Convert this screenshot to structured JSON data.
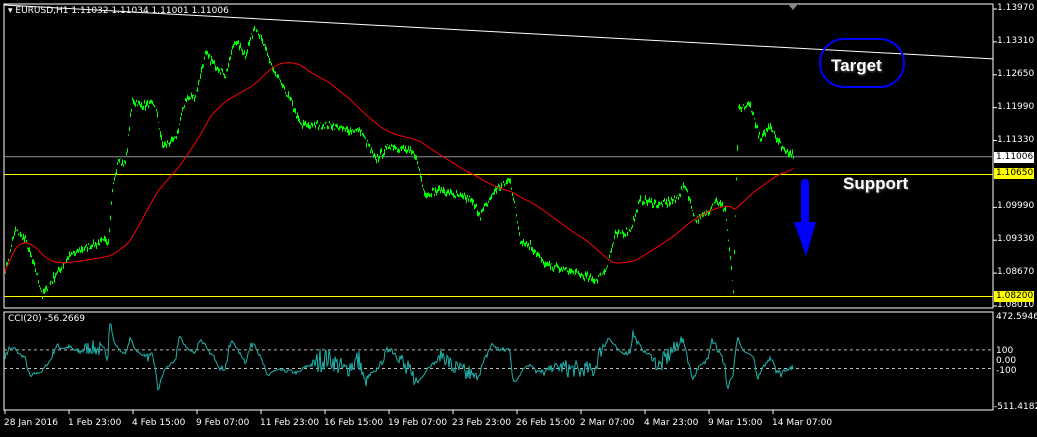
{
  "header": {
    "symbol_line": "EURUSD,H1  1.11032 1.11034 1.11001 1.11006"
  },
  "price_axis": {
    "ticks": [
      "1.13970",
      "1.13310",
      "1.12650",
      "1.11990",
      "1.11330",
      "1.09990",
      "1.09330",
      "1.08670",
      "1.08010"
    ],
    "tick_values": [
      1.1397,
      1.1331,
      1.1265,
      1.1199,
      1.1133,
      1.0999,
      1.0933,
      1.0867,
      1.0801
    ],
    "range": [
      1.0801,
      1.1397
    ],
    "current_price_label": "1.11006",
    "support_label": "1.10650",
    "lower_label": "1.08200"
  },
  "levels": {
    "current": 1.11006,
    "support": 1.1065,
    "lower": 1.082,
    "trendline_start": 1.1405,
    "trendline_end": 1.1297
  },
  "colors": {
    "price": "#00ff00",
    "ma": "#ff0000",
    "level": "#ffff00",
    "cci": "#20b2aa",
    "trend": "#ffffff",
    "annotation": "#0000ff"
  },
  "annotations": {
    "target": "Target",
    "support": "Support"
  },
  "indicator": {
    "label": "CCI(20) -56.2669",
    "top": "472.5946",
    "bottom": "-511.4182",
    "upper": "100",
    "zero": "0.00",
    "lower": "-100"
  },
  "time_axis": [
    "28 Jan 2016",
    "1 Feb 23:00",
    "4 Feb 15:00",
    "9 Feb 07:00",
    "11 Feb 23:00",
    "16 Feb 15:00",
    "19 Feb 07:00",
    "23 Feb 23:00",
    "26 Feb 15:00",
    "2 Mar 07:00",
    "4 Mar 23:00",
    "9 Mar 15:00",
    "14 Mar 07:00"
  ],
  "chart_data": {
    "type": "line",
    "title": "EURUSD,H1",
    "bars_total": 789,
    "price_keypoints": [
      [
        0,
        1.0873
      ],
      [
        10,
        1.0954
      ],
      [
        20,
        1.0933
      ],
      [
        30,
        1.0873
      ],
      [
        37,
        1.0823
      ],
      [
        50,
        1.0863
      ],
      [
        65,
        1.0903
      ],
      [
        85,
        1.0923
      ],
      [
        103,
        1.0933
      ],
      [
        107,
        1.1034
      ],
      [
        113,
        1.1094
      ],
      [
        120,
        1.1084
      ],
      [
        127,
        1.1214
      ],
      [
        135,
        1.1204
      ],
      [
        150,
        1.1204
      ],
      [
        157,
        1.1124
      ],
      [
        170,
        1.1134
      ],
      [
        180,
        1.1214
      ],
      [
        190,
        1.1224
      ],
      [
        200,
        1.1305
      ],
      [
        210,
        1.1285
      ],
      [
        220,
        1.1265
      ],
      [
        230,
        1.1335
      ],
      [
        240,
        1.1305
      ],
      [
        250,
        1.1365
      ],
      [
        260,
        1.1315
      ],
      [
        270,
        1.1265
      ],
      [
        285,
        1.1214
      ],
      [
        295,
        1.1164
      ],
      [
        310,
        1.1164
      ],
      [
        325,
        1.1164
      ],
      [
        340,
        1.1154
      ],
      [
        355,
        1.1154
      ],
      [
        370,
        1.1094
      ],
      [
        385,
        1.1124
      ],
      [
        400,
        1.1114
      ],
      [
        410,
        1.1104
      ],
      [
        420,
        1.1024
      ],
      [
        435,
        1.1034
      ],
      [
        450,
        1.1024
      ],
      [
        465,
        1.1014
      ],
      [
        475,
        1.0984
      ],
      [
        490,
        1.1034
      ],
      [
        505,
        1.1054
      ],
      [
        515,
        1.0933
      ],
      [
        525,
        1.0923
      ],
      [
        540,
        1.0883
      ],
      [
        560,
        1.0873
      ],
      [
        575,
        1.0863
      ],
      [
        590,
        1.0853
      ],
      [
        600,
        1.0873
      ],
      [
        610,
        1.0943
      ],
      [
        625,
        1.0954
      ],
      [
        635,
        1.1014
      ],
      [
        655,
        1.1004
      ],
      [
        670,
        1.1014
      ],
      [
        680,
        1.1044
      ],
      [
        690,
        1.0974
      ],
      [
        700,
        1.0984
      ],
      [
        710,
        1.1014
      ],
      [
        720,
        1.0994
      ],
      [
        728,
        1.0833
      ],
      [
        733,
        1.1194
      ],
      [
        745,
        1.1204
      ],
      [
        755,
        1.1134
      ],
      [
        765,
        1.1164
      ],
      [
        775,
        1.1124
      ],
      [
        788,
        1.11006
      ]
    ],
    "ma_period": 100,
    "cci_period": 20,
    "cci_range": [
      -511.4182,
      472.5946
    ],
    "cci_levels": [
      100,
      0,
      -100
    ]
  }
}
